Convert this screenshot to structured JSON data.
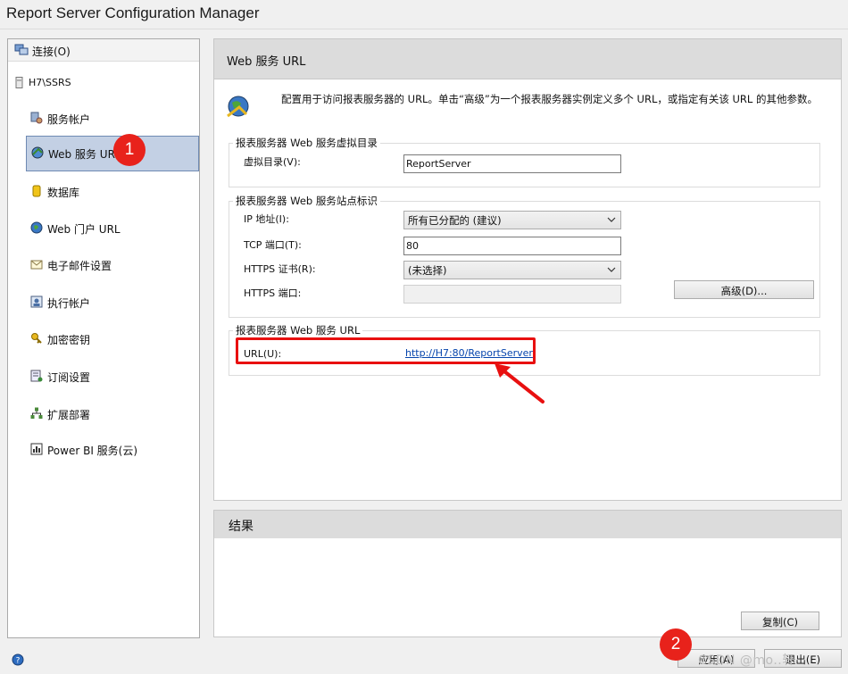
{
  "window": {
    "title": "Report Server Configuration Manager"
  },
  "sidebar": {
    "connect_label": "连接(O)",
    "server": "H7\\SSRS",
    "items": [
      {
        "label": "服务帐户",
        "icon": "service-account-icon"
      },
      {
        "label": "Web 服务 URL",
        "icon": "web-service-url-icon",
        "active": true
      },
      {
        "label": "数据库",
        "icon": "database-icon"
      },
      {
        "label": "Web 门户 URL",
        "icon": "globe-icon"
      },
      {
        "label": "电子邮件设置",
        "icon": "email-icon"
      },
      {
        "label": "执行帐户",
        "icon": "execution-account-icon"
      },
      {
        "label": "加密密钥",
        "icon": "key-icon"
      },
      {
        "label": "订阅设置",
        "icon": "subscription-icon"
      },
      {
        "label": "扩展部署",
        "icon": "scale-out-icon"
      },
      {
        "label": "Power BI 服务(云)",
        "icon": "power-bi-icon"
      }
    ]
  },
  "main": {
    "header": "Web 服务 URL",
    "description": "配置用于访问报表服务器的 URL。单击“高级”为一个报表服务器实例定义多个 URL，或指定有关该 URL 的其他参数。",
    "vdir_group": {
      "legend": "报表服务器 Web 服务虚拟目录",
      "label": "虚拟目录(V):",
      "value": "ReportServer"
    },
    "site_group": {
      "legend": "报表服务器 Web 服务站点标识",
      "ip_label": "IP 地址(I):",
      "ip_value": "所有已分配的 (建议)",
      "tcp_label": "TCP 端口(T):",
      "tcp_value": "80",
      "cert_label": "HTTPS 证书(R):",
      "cert_value": "(未选择)",
      "https_port_label": "HTTPS 端口:",
      "https_port_value": "",
      "advanced_button": "高级(D)..."
    },
    "url_group": {
      "legend": "报表服务器 Web 服务 URL",
      "label": "URL(U):",
      "url": "http://H7:80/ReportServer"
    }
  },
  "result": {
    "header": "结果",
    "copy_button": "复制(C)"
  },
  "footer": {
    "apply_button": "应用(A)",
    "exit_button": "退出(E)",
    "help_icon": "help-icon"
  },
  "annotations": {
    "badge1": "1",
    "badge2": "2",
    "watermark": "CSDN @mo..轩"
  },
  "colors": {
    "annotation_red": "#e8221b",
    "active_item": "#c3d0e4",
    "link": "#0645ad"
  }
}
